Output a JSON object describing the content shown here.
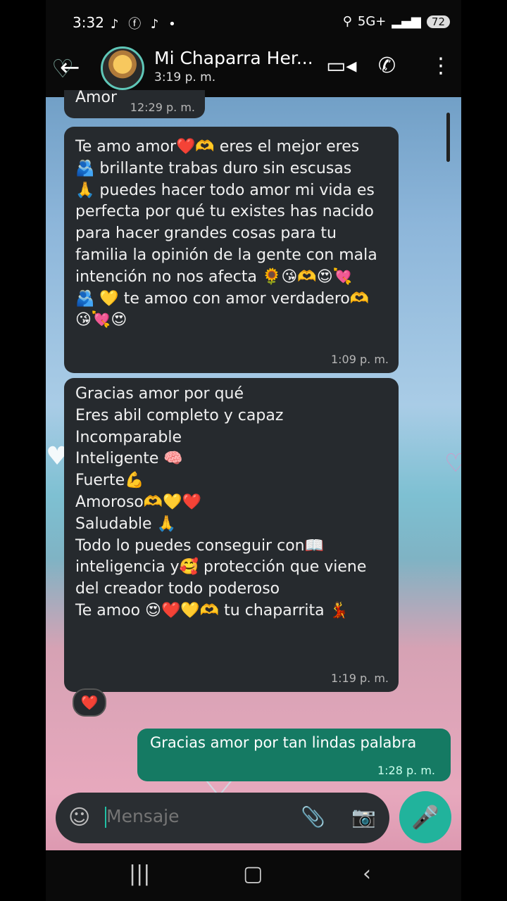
{
  "status": {
    "time": "3:32",
    "left_icons": "♪ ⓕ ♪ •",
    "network": "5G+",
    "battery": "72"
  },
  "header": {
    "name": "Mi Chaparra Her...",
    "last_seen": "3:19 p. m."
  },
  "messages": [
    {
      "text": "Amor",
      "time": "12:29 p. m."
    },
    {
      "text": "Te amo amor❤️🫶 eres el mejor eres\n🫂 brillante trabas duro sin escusas\n🙏 puedes hacer todo amor mi vida es perfecta por qué tu existes has nacido para hacer grandes cosas para tu familia la opinión de la gente con mala intención no nos afecta 🌻😘🫶😍💘\n🫂 💛 te amoo con amor verdadero🫶\n😘💘😍",
      "time": "1:09 p. m."
    },
    {
      "text": "Gracias amor por qué\nEres abil completo y capaz\nIncomparable\nInteligente 🧠\nFuerte💪\nAmoroso🫶💛❤️\nSaludable 🙏\nTodo lo puedes conseguir con📖\ninteligencia y🥰 protección que viene del creador todo poderoso\nTe amoo 😍❤️💛🫶 tu chaparrita 💃",
      "time": "1:19 p. m.",
      "reaction": "❤️"
    },
    {
      "text": "Gracias amor por tan lindas palabra",
      "time": "1:28 p. m."
    }
  ],
  "composer": {
    "placeholder": "Mensaje"
  },
  "icons": {
    "back": "arrow-left",
    "video": "video-call",
    "call": "phone",
    "menu": "more-vertical",
    "sticker": "sticker",
    "attach": "paperclip",
    "camera": "camera",
    "mic": "microphone"
  }
}
